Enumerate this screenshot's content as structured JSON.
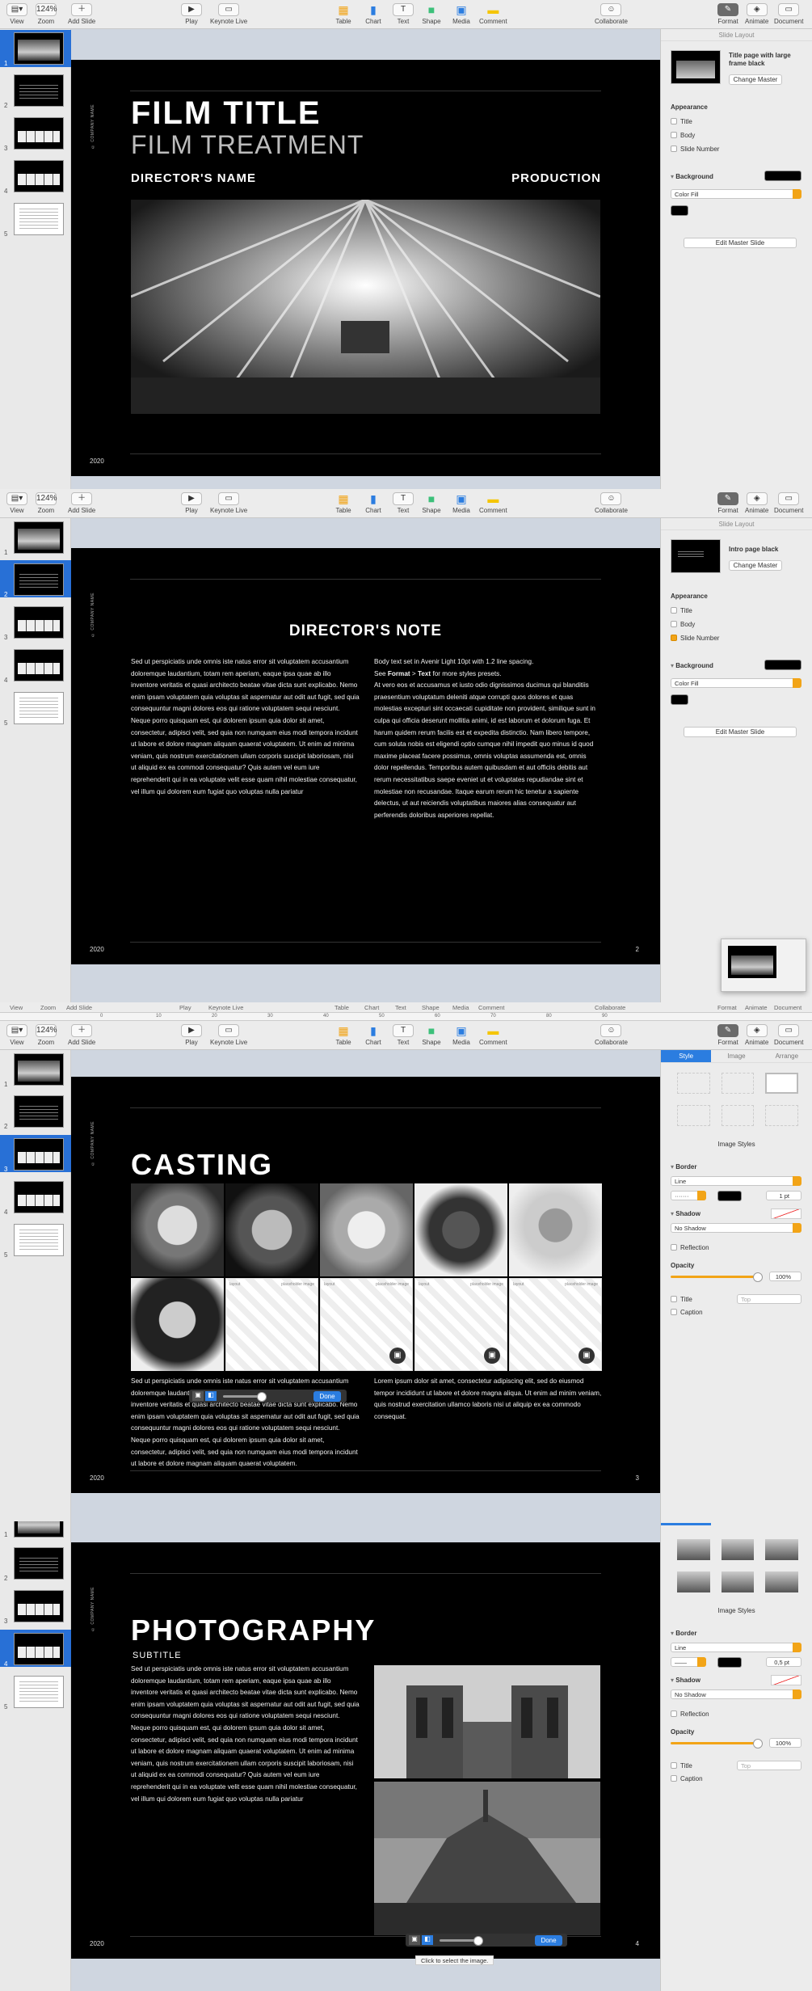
{
  "toolbar": {
    "view": "View",
    "zoom": "Zoom",
    "zoom_value": "124%",
    "add_slide": "Add Slide",
    "play": "Play",
    "keynote_live": "Keynote Live",
    "table": "Table",
    "chart": "Chart",
    "text": "Text",
    "shape": "Shape",
    "media": "Media",
    "comment": "Comment",
    "collaborate": "Collaborate",
    "format": "Format",
    "animate": "Animate",
    "document": "Document"
  },
  "navigator": {
    "slide_numbers": [
      "1",
      "2",
      "3",
      "4",
      "5"
    ]
  },
  "slide1": {
    "company": "© COMPANY NAME",
    "title": "FILM TITLE",
    "subtitle": "FILM TREATMENT",
    "director": "DIRECTOR'S NAME",
    "production": "PRODUCTION",
    "year": "2020"
  },
  "slide2": {
    "company": "© COMPANY NAME",
    "heading": "DIRECTOR'S NOTE",
    "col_left": "Sed ut perspiciatis unde omnis iste natus error sit voluptatem accusantium doloremque laudantium, totam rem aperiam, eaque ipsa quae ab illo inventore veritatis et quasi architecto beatae vitae dicta sunt explicabo. Nemo enim ipsam voluptatem quia voluptas sit aspernatur aut odit aut fugit, sed quia consequuntur magni dolores eos qui ratione voluptatem sequi nesciunt. Neque porro quisquam est, qui dolorem ipsum quia dolor sit amet, consectetur, adipisci velit, sed quia non numquam eius modi tempora incidunt ut labore et dolore magnam aliquam quaerat voluptatem. Ut enim ad minima veniam, quis nostrum exercitationem ullam corporis suscipit laboriosam, nisi ut aliquid ex ea commodi consequatur? Quis autem vel eum iure reprehenderit qui in ea voluptate velit esse quam nihil molestiae consequatur, vel illum qui dolorem eum fugiat quo voluptas nulla pariatur",
    "col_right_1": "Body text set in Avenir Light 10pt with 1.2 line spacing.",
    "col_right_2a": "See ",
    "col_right_2b": "Format",
    "col_right_2c": " > ",
    "col_right_2d": "Text",
    "col_right_2e": " for more styles presets.",
    "col_right_3": "At vero eos et accusamus et iusto odio dignissimos ducimus qui blanditiis praesentium voluptatum deleniti atque corrupti quos dolores et quas molestias excepturi sint occaecati cupiditate non provident, similique sunt in culpa qui officia deserunt mollitia animi, id est laborum et dolorum fuga. Et harum quidem rerum facilis est et expedita distinctio. Nam libero tempore, cum soluta nobis est eligendi optio cumque nihil impedit quo minus id quod maxime placeat facere possimus, omnis voluptas assumenda est, omnis dolor repellendus. Temporibus autem quibusdam et aut officiis debitis aut rerum necessitatibus saepe eveniet ut et voluptates repudiandae sint et molestiae non recusandae. Itaque earum rerum hic tenetur a sapiente delectus, ut aut reiciendis voluptatibus maiores alias consequatur aut perferendis doloribus asperiores repellat.",
    "year": "2020",
    "page": "2"
  },
  "slide3": {
    "company": "© COMPANY NAME",
    "heading": "CASTING",
    "placeholder_left": "layout",
    "placeholder_right": "placeholder image",
    "body_left": "Sed ut perspiciatis unde omnis iste natus error sit voluptatem accusantium doloremque laudantium, totam rem aperiam, eaque ipsa quae ab illo inventore veritatis et quasi architecto beatae vitae dicta sunt explicabo. Nemo enim ipsam voluptatem quia voluptas sit aspernatur aut odit aut fugit, sed quia consequuntur magni dolores eos qui ratione voluptatem sequi nesciunt. Neque porro quisquam est, qui dolorem ipsum quia dolor sit amet, consectetur, adipisci velit, sed quia non numquam eius modi tempora incidunt ut labore et dolore magnam aliquam quaerat voluptatem.",
    "body_right": "Lorem ipsum dolor sit amet, consectetur adipiscing elit, sed do eiusmod tempor incididunt ut labore et dolore magna aliqua. Ut enim ad minim veniam, quis nostrud exercitation ullamco laboris nisi ut aliquip ex ea commodo consequat.",
    "done": "Done",
    "year": "2020",
    "page": "3"
  },
  "slide4": {
    "company": "© COMPANY NAME",
    "heading": "PHOTOGRAPHY",
    "subtitle": "SUBTITLE",
    "body": "Sed ut perspiciatis unde omnis iste natus error sit voluptatem accusantium doloremque laudantium, totam rem aperiam, eaque ipsa quae ab illo inventore veritatis et quasi architecto beatae vitae dicta sunt explicabo. Nemo enim ipsam voluptatem quia voluptas sit aspernatur aut odit aut fugit, sed quia consequuntur magni dolores eos qui ratione voluptatem sequi nesciunt. Neque porro quisquam est, qui dolorem ipsum quia dolor sit amet, consectetur, adipisci velit, sed quia non numquam eius modi tempora incidunt ut labore et dolore magnam aliquam quaerat voluptatem. Ut enim ad minima veniam, quis nostrum exercitationem ullam corporis suscipit laboriosam, nisi ut aliquid ex ea commodi consequatur? Quis autem vel eum iure reprehenderit qui in ea voluptate velit esse quam nihil molestiae consequatur, vel illum qui dolorem eum fugiat quo voluptas nulla pariatur",
    "done": "Done",
    "tooltip": "Click to select the image.",
    "year": "2020",
    "page": "4"
  },
  "inspector1": {
    "header": "Slide Layout",
    "layout_name": "Title page with large frame black",
    "change_master": "Change Master",
    "appearance": "Appearance",
    "title": "Title",
    "body": "Body",
    "slide_number": "Slide Number",
    "background": "Background",
    "fill": "Color Fill",
    "edit_master": "Edit Master Slide"
  },
  "inspector2": {
    "header": "Slide Layout",
    "layout_name": "Intro page black",
    "change_master": "Change Master",
    "appearance": "Appearance",
    "title": "Title",
    "body": "Body",
    "slide_number": "Slide Number",
    "background": "Background",
    "fill": "Color Fill",
    "edit_master": "Edit Master Slide"
  },
  "inspector3": {
    "tabs": [
      "Style",
      "Image",
      "Arrange"
    ],
    "image_styles": "Image Styles",
    "border": "Border",
    "line": "Line",
    "border_width": "1 pt",
    "shadow": "Shadow",
    "no_shadow": "No Shadow",
    "reflection": "Reflection",
    "opacity": "Opacity",
    "opacity_value": "100%",
    "title": "Title",
    "title_pos": "Top",
    "caption": "Caption"
  },
  "inspector4": {
    "image_styles": "Image Styles",
    "border": "Border",
    "line": "Line",
    "border_width": "0,5 pt",
    "shadow": "Shadow",
    "no_shadow": "No Shadow",
    "reflection": "Reflection",
    "opacity": "Opacity",
    "opacity_value": "100%",
    "title": "Title",
    "title_pos": "Top",
    "caption": "Caption"
  },
  "ruler": {
    "ticks": [
      "0",
      "10",
      "20",
      "30",
      "40",
      "50",
      "60",
      "70",
      "80",
      "90"
    ]
  },
  "colors": {
    "accent": "#2870d6",
    "orange": "#f2a417",
    "slide_bg": "#000000"
  }
}
